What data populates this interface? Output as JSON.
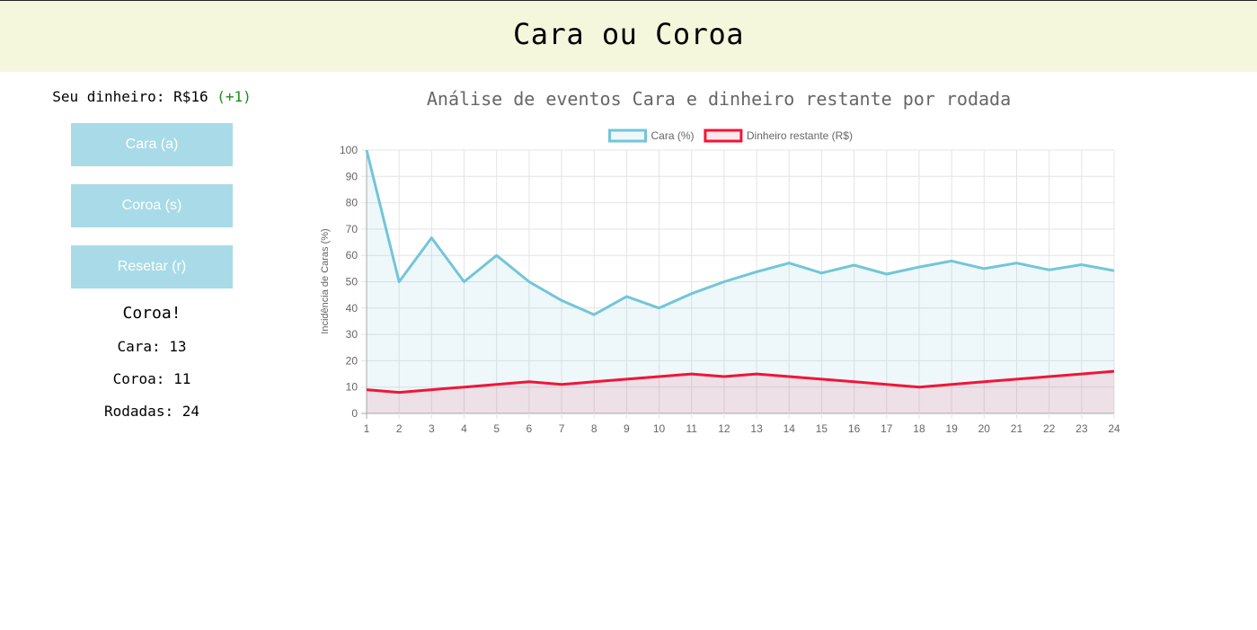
{
  "header": {
    "title": "Cara ou Coroa"
  },
  "wallet": {
    "label": "Seu dinheiro: R$16",
    "delta": "(+1)"
  },
  "controls": {
    "cara_label": "Cara (a)",
    "coroa_label": "Coroa (s)",
    "reset_label": "Resetar (r)"
  },
  "result": {
    "text": "Coroa!"
  },
  "stats": {
    "cara": "Cara: 13",
    "coroa": "Coroa: 11",
    "rodadas": "Rodadas: 24"
  },
  "colors": {
    "header_bg": "#f5f7dc",
    "button_bg": "#a8dbe7",
    "delta_green": "#1a8f1a",
    "series_cara": "#72c6d9",
    "series_money": "#f0153a"
  },
  "chart_data": {
    "type": "line",
    "title": "Análise de eventos Cara e dinheiro restante por rodada",
    "xlabel": "",
    "ylabel": "Incidência de Caras (%)",
    "ylim": [
      0,
      100
    ],
    "y_ticks": [
      0,
      10,
      20,
      30,
      40,
      50,
      60,
      70,
      80,
      90,
      100
    ],
    "x": [
      1,
      2,
      3,
      4,
      5,
      6,
      7,
      8,
      9,
      10,
      11,
      12,
      13,
      14,
      15,
      16,
      17,
      18,
      19,
      20,
      21,
      22,
      23,
      24
    ],
    "grid": true,
    "legend_position": "top",
    "series": [
      {
        "name": "Cara (%)",
        "color": "#72c6d9",
        "fill": "rgba(114,198,217,0.12)",
        "values": [
          100,
          50,
          66.7,
          50,
          60,
          50,
          42.9,
          37.5,
          44.4,
          40,
          45.5,
          50,
          53.8,
          57.1,
          53.3,
          56.3,
          52.9,
          55.6,
          57.9,
          55,
          57.1,
          54.5,
          56.5,
          54.2
        ]
      },
      {
        "name": "Dinheiro restante (R$)",
        "color": "#f0153a",
        "fill": "rgba(240,21,58,0.10)",
        "values": [
          9,
          8,
          9,
          10,
          11,
          12,
          11,
          12,
          13,
          14,
          15,
          14,
          15,
          14,
          13,
          12,
          11,
          10,
          11,
          12,
          13,
          14,
          15,
          16
        ]
      }
    ]
  }
}
